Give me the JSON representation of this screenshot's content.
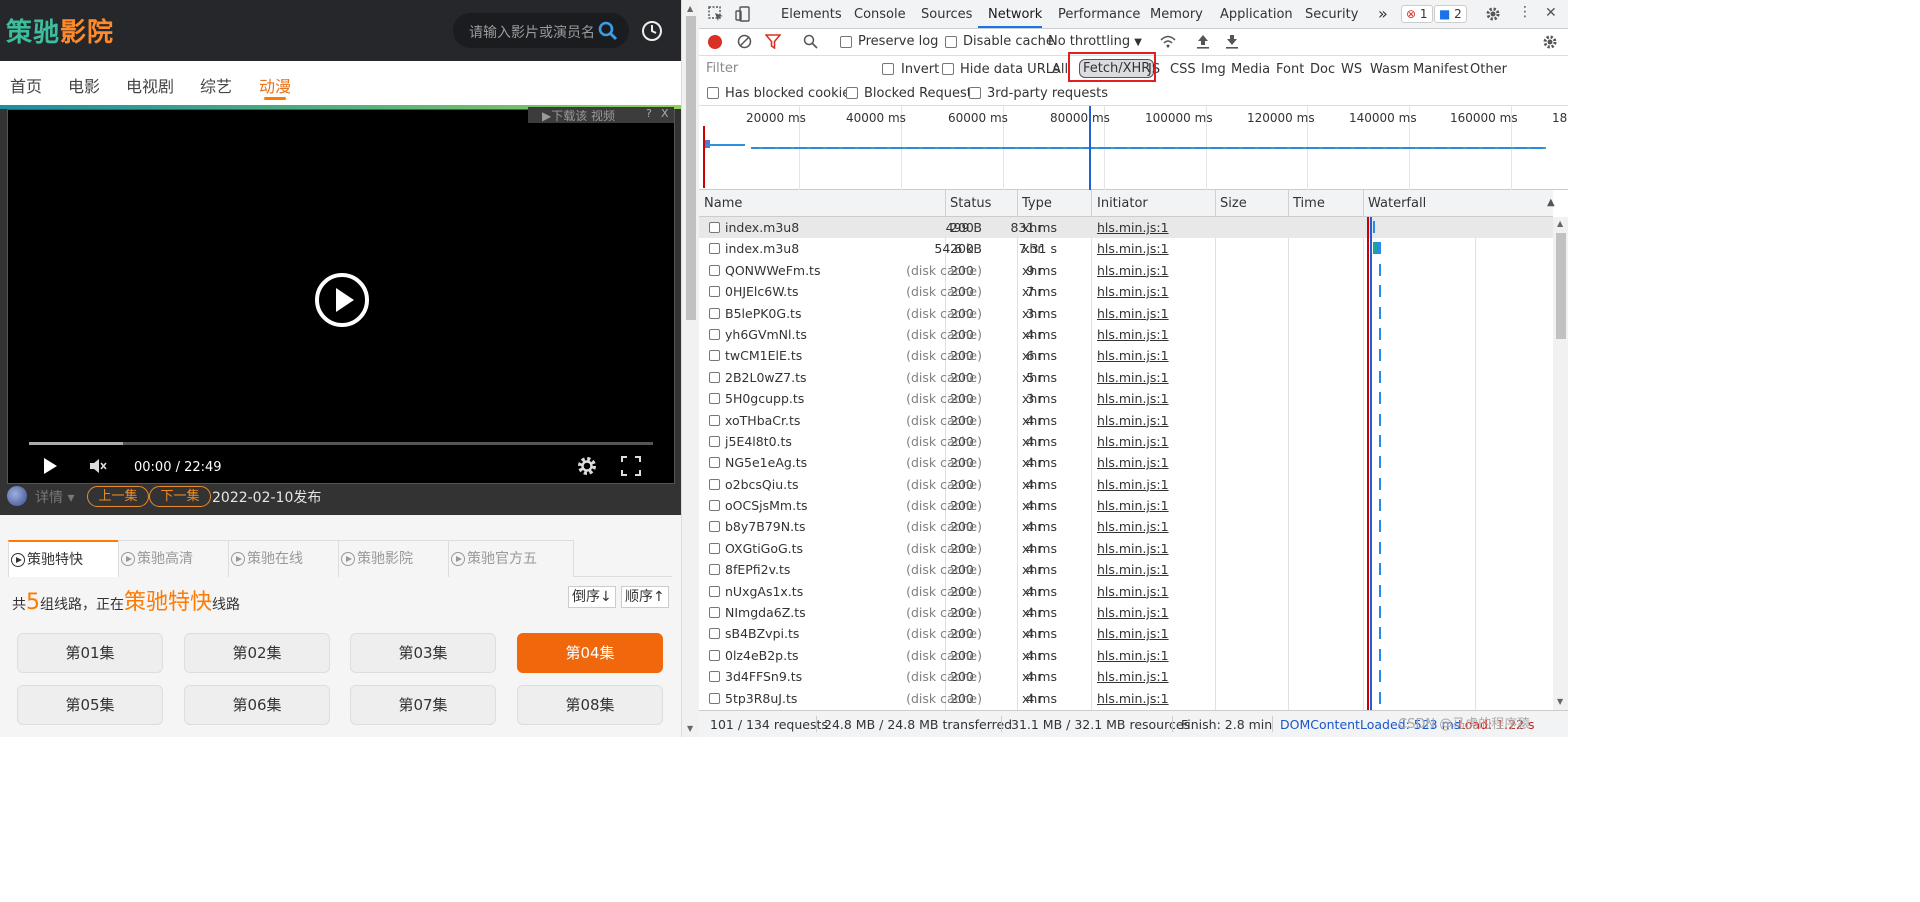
{
  "site": {
    "logo_part1": "策驰",
    "logo_part2": "影院",
    "search_placeholder": "请输入影片或演员名称",
    "nav": [
      "首页",
      "电影",
      "电视剧",
      "综艺",
      "动漫"
    ],
    "nav_active": "动漫"
  },
  "player": {
    "download_label": "▶下载该 视频",
    "help": "?",
    "close": "X",
    "time": "00:00 / 22:49",
    "progress": 0.15,
    "detail_label": "详情",
    "prev_label": "上一集",
    "next_label": "下一集",
    "release_date": "2022-02-10发布"
  },
  "routes": {
    "tabs": [
      "策驰特快",
      "策驰高清",
      "策驰在线",
      "策驰影院",
      "策驰官方五"
    ],
    "active_tab": "策驰特快",
    "summary_pre": "共",
    "summary_count": "5",
    "summary_mid": "组线路，正在",
    "summary_current": "策驰特快",
    "summary_post": "线路",
    "sort_desc": "倒序↓",
    "sort_asc": "顺序↑"
  },
  "episodes": [
    "第01集",
    "第02集",
    "第03集",
    "第04集",
    "第05集",
    "第06集",
    "第07集",
    "第08集"
  ],
  "episode_active": "第04集",
  "devtools": {
    "tabs": [
      "Elements",
      "Console",
      "Sources",
      "Network",
      "Performance",
      "Memory",
      "Application",
      "Security"
    ],
    "active_tab": "Network",
    "more": "»",
    "errors": "1",
    "messages": "2",
    "toolbar": {
      "preserve_log": "Preserve log",
      "disable_cache": "Disable cache",
      "throttling": "No throttling"
    },
    "filter": {
      "placeholder": "Filter",
      "invert": "Invert",
      "hide_data_urls": "Hide data URLs",
      "types": [
        "All",
        "Fetch/XHR",
        "JS",
        "CSS",
        "Img",
        "Media",
        "Font",
        "Doc",
        "WS",
        "Wasm",
        "Manifest",
        "Other"
      ],
      "selected": "Fetch/XHR",
      "has_blocked_cookies": "Has blocked cookies",
      "blocked_requests": "Blocked Requests",
      "third_party": "3rd-party requests"
    },
    "overview_ticks": [
      "20000 ms",
      "40000 ms",
      "60000 ms",
      "80000 ms",
      "100000 ms",
      "120000 ms",
      "140000 ms",
      "160000 ms",
      "18"
    ],
    "columns": {
      "name": "Name",
      "status": "Status",
      "type": "Type",
      "initiator": "Initiator",
      "size": "Size",
      "time": "Time",
      "waterfall": "Waterfall",
      "sort_arrow": "▲"
    },
    "requests": [
      {
        "name": "index.m3u8",
        "status": "200",
        "type": "xhr",
        "initiator": "hls.min.js:1",
        "size": "499 B",
        "time": "831 ms"
      },
      {
        "name": "index.m3u8",
        "status": "200",
        "type": "xhr",
        "initiator": "hls.min.js:1",
        "size": "54.6 kB",
        "time": "7.31 s"
      },
      {
        "name": "QONWWeFm.ts",
        "status": "200",
        "type": "xhr",
        "initiator": "hls.min.js:1",
        "size": "(disk cache)",
        "time": "9 ms"
      },
      {
        "name": "0HJElc6W.ts",
        "status": "200",
        "type": "xhr",
        "initiator": "hls.min.js:1",
        "size": "(disk cache)",
        "time": "7 ms"
      },
      {
        "name": "B5lePK0G.ts",
        "status": "200",
        "type": "xhr",
        "initiator": "hls.min.js:1",
        "size": "(disk cache)",
        "time": "3 ms"
      },
      {
        "name": "yh6GVmNl.ts",
        "status": "200",
        "type": "xhr",
        "initiator": "hls.min.js:1",
        "size": "(disk cache)",
        "time": "4 ms"
      },
      {
        "name": "twCM1ElE.ts",
        "status": "200",
        "type": "xhr",
        "initiator": "hls.min.js:1",
        "size": "(disk cache)",
        "time": "6 ms"
      },
      {
        "name": "2B2L0wZ7.ts",
        "status": "200",
        "type": "xhr",
        "initiator": "hls.min.js:1",
        "size": "(disk cache)",
        "time": "5 ms"
      },
      {
        "name": "5H0gcupp.ts",
        "status": "200",
        "type": "xhr",
        "initiator": "hls.min.js:1",
        "size": "(disk cache)",
        "time": "3 ms"
      },
      {
        "name": "xoTHbaCr.ts",
        "status": "200",
        "type": "xhr",
        "initiator": "hls.min.js:1",
        "size": "(disk cache)",
        "time": "4 ms"
      },
      {
        "name": "j5E4l8t0.ts",
        "status": "200",
        "type": "xhr",
        "initiator": "hls.min.js:1",
        "size": "(disk cache)",
        "time": "4 ms"
      },
      {
        "name": "NG5e1eAg.ts",
        "status": "200",
        "type": "xhr",
        "initiator": "hls.min.js:1",
        "size": "(disk cache)",
        "time": "4 ms"
      },
      {
        "name": "o2bcsQiu.ts",
        "status": "200",
        "type": "xhr",
        "initiator": "hls.min.js:1",
        "size": "(disk cache)",
        "time": "4 ms"
      },
      {
        "name": "oOCSjsMm.ts",
        "status": "200",
        "type": "xhr",
        "initiator": "hls.min.js:1",
        "size": "(disk cache)",
        "time": "4 ms"
      },
      {
        "name": "b8y7B79N.ts",
        "status": "200",
        "type": "xhr",
        "initiator": "hls.min.js:1",
        "size": "(disk cache)",
        "time": "4 ms"
      },
      {
        "name": "OXGtiGoG.ts",
        "status": "200",
        "type": "xhr",
        "initiator": "hls.min.js:1",
        "size": "(disk cache)",
        "time": "4 ms"
      },
      {
        "name": "8fEPfi2v.ts",
        "status": "200",
        "type": "xhr",
        "initiator": "hls.min.js:1",
        "size": "(disk cache)",
        "time": "4 ms"
      },
      {
        "name": "nUxgAs1x.ts",
        "status": "200",
        "type": "xhr",
        "initiator": "hls.min.js:1",
        "size": "(disk cache)",
        "time": "4 ms"
      },
      {
        "name": "NImgda6Z.ts",
        "status": "200",
        "type": "xhr",
        "initiator": "hls.min.js:1",
        "size": "(disk cache)",
        "time": "4 ms"
      },
      {
        "name": "sB4BZvpi.ts",
        "status": "200",
        "type": "xhr",
        "initiator": "hls.min.js:1",
        "size": "(disk cache)",
        "time": "4 ms"
      },
      {
        "name": "0lz4eB2p.ts",
        "status": "200",
        "type": "xhr",
        "initiator": "hls.min.js:1",
        "size": "(disk cache)",
        "time": "4 ms"
      },
      {
        "name": "3d4FFSn9.ts",
        "status": "200",
        "type": "xhr",
        "initiator": "hls.min.js:1",
        "size": "(disk cache)",
        "time": "4 ms"
      },
      {
        "name": "5tp3R8uJ.ts",
        "status": "200",
        "type": "xhr",
        "initiator": "hls.min.js:1",
        "size": "(disk cache)",
        "time": "4 ms"
      }
    ],
    "statusbar": {
      "requests": "101 / 134 requests",
      "transferred": "24.8 MB / 24.8 MB transferred",
      "resources": "31.1 MB / 32.1 MB resources",
      "finish": "Finish: 2.8 min",
      "dom_loaded": "DOMContentLoaded: 523 ms",
      "load": "Load: 1.22 s"
    },
    "watermark": "CSDN @马虎的程序猿"
  }
}
